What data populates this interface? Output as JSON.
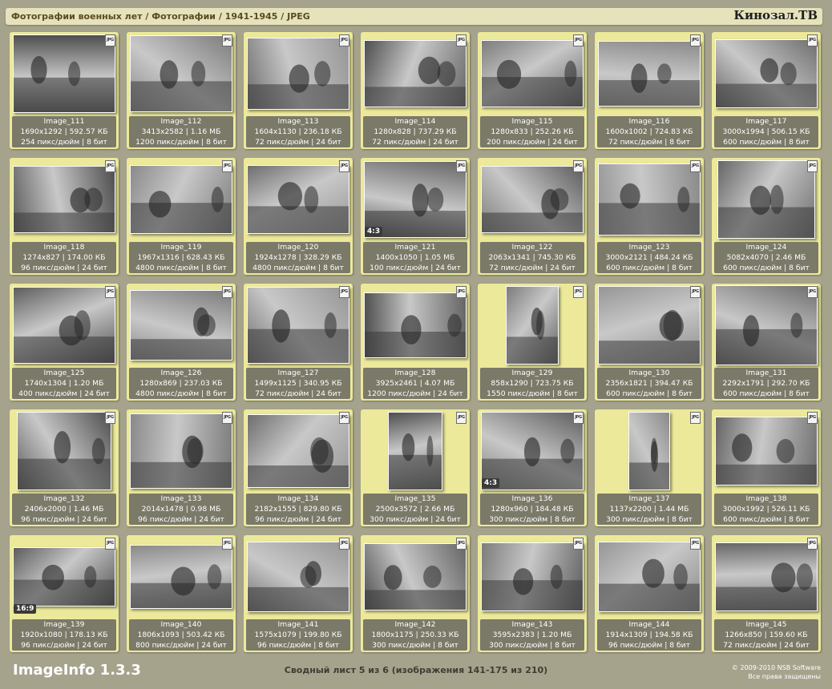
{
  "header": {
    "breadcrumb": "Фотографии военных лет / Фотографии / 1941-1945 / JPEG",
    "site": "Кинозал.ТВ"
  },
  "footer": {
    "app_name": "ImageInfo 1.3.3",
    "summary": "Сводный лист 5 из 6 (изображения 141-175 из 210)",
    "copyright": "© 2009-2010 NSB Software",
    "rights": "Все права защищены"
  },
  "file_type_icon": "jpg-file-icon",
  "images": [
    {
      "name": "Image_111",
      "dims": "1690x1292 | 592.57 КБ",
      "meta": "254 пикс/дюйм | 8 бит"
    },
    {
      "name": "Image_112",
      "dims": "3413x2582 | 1.16 МБ",
      "meta": "1200 пикс/дюйм | 8 бит"
    },
    {
      "name": "Image_113",
      "dims": "1604x1130 | 236.18 КБ",
      "meta": "72 пикс/дюйм | 24 бит"
    },
    {
      "name": "Image_114",
      "dims": "1280x828 | 737.29 КБ",
      "meta": "72 пикс/дюйм | 24 бит"
    },
    {
      "name": "Image_115",
      "dims": "1280x833 | 252.26 КБ",
      "meta": "200 пикс/дюйм | 24 бит"
    },
    {
      "name": "Image_116",
      "dims": "1600x1002 | 724.83 КБ",
      "meta": "72 пикс/дюйм | 8 бит"
    },
    {
      "name": "Image_117",
      "dims": "3000x1994 | 506.15 КБ",
      "meta": "600 пикс/дюйм | 8 бит"
    },
    {
      "name": "Image_118",
      "dims": "1274x827 | 174.00 КБ",
      "meta": "96 пикс/дюйм | 24 бит"
    },
    {
      "name": "Image_119",
      "dims": "1967x1316 | 628.43 КБ",
      "meta": "4800 пикс/дюйм | 8 бит"
    },
    {
      "name": "Image_120",
      "dims": "1924x1278 | 328.29 КБ",
      "meta": "4800 пикс/дюйм | 8 бит"
    },
    {
      "name": "Image_121",
      "dims": "1400x1050 | 1.05 МБ",
      "meta": "100 пикс/дюйм | 24 бит",
      "badge": "4:3"
    },
    {
      "name": "Image_122",
      "dims": "2063x1341 | 745.30 КБ",
      "meta": "72 пикс/дюйм | 24 бит"
    },
    {
      "name": "Image_123",
      "dims": "3000x2121 | 484.24 КБ",
      "meta": "600 пикс/дюйм | 8 бит"
    },
    {
      "name": "Image_124",
      "dims": "5082x4070 | 2.46 МБ",
      "meta": "600 пикс/дюйм | 8 бит"
    },
    {
      "name": "Image_125",
      "dims": "1740x1304 | 1.20 МБ",
      "meta": "400 пикс/дюйм | 24 бит"
    },
    {
      "name": "Image_126",
      "dims": "1280x869 | 237.03 КБ",
      "meta": "4800 пикс/дюйм | 8 бит"
    },
    {
      "name": "Image_127",
      "dims": "1499x1125 | 340.95 КБ",
      "meta": "72 пикс/дюйм | 24 бит"
    },
    {
      "name": "Image_128",
      "dims": "3925x2461 | 4.07 МБ",
      "meta": "1200 пикс/дюйм | 24 бит"
    },
    {
      "name": "Image_129",
      "dims": "858x1290 | 723.75 КБ",
      "meta": "1550 пикс/дюйм | 8 бит"
    },
    {
      "name": "Image_130",
      "dims": "2356x1821 | 394.47 КБ",
      "meta": "600 пикс/дюйм | 8 бит"
    },
    {
      "name": "Image_131",
      "dims": "2292x1791 | 292.70 КБ",
      "meta": "600 пикс/дюйм | 8 бит"
    },
    {
      "name": "Image_132",
      "dims": "2406x2000 | 1.46 МБ",
      "meta": "96 пикс/дюйм | 24 бит"
    },
    {
      "name": "Image_133",
      "dims": "2014x1478 | 0.98 МБ",
      "meta": "96 пикс/дюйм | 24 бит"
    },
    {
      "name": "Image_134",
      "dims": "2182x1555 | 829.80 КБ",
      "meta": "96 пикс/дюйм | 24 бит"
    },
    {
      "name": "Image_135",
      "dims": "2500x3572 | 2.66 МБ",
      "meta": "300 пикс/дюйм | 24 бит"
    },
    {
      "name": "Image_136",
      "dims": "1280x960 | 184.48 КБ",
      "meta": "300 пикс/дюйм | 8 бит",
      "badge": "4:3"
    },
    {
      "name": "Image_137",
      "dims": "1137x2200 | 1.44 МБ",
      "meta": "300 пикс/дюйм | 8 бит"
    },
    {
      "name": "Image_138",
      "dims": "3000x1992 | 526.11 КБ",
      "meta": "600 пикс/дюйм | 8 бит"
    },
    {
      "name": "Image_139",
      "dims": "1920x1080 | 178.13 КБ",
      "meta": "96 пикс/дюйм | 24 бит",
      "badge": "16:9"
    },
    {
      "name": "Image_140",
      "dims": "1806x1093 | 503.42 КБ",
      "meta": "800 пикс/дюйм | 24 бит"
    },
    {
      "name": "Image_141",
      "dims": "1575x1079 | 199.80 КБ",
      "meta": "96 пикс/дюйм | 8 бит"
    },
    {
      "name": "Image_142",
      "dims": "1800x1175 | 250.33 КБ",
      "meta": "300 пикс/дюйм | 8 бит"
    },
    {
      "name": "Image_143",
      "dims": "3595x2383 | 1.20 МБ",
      "meta": "300 пикс/дюйм | 8 бит"
    },
    {
      "name": "Image_144",
      "dims": "1914x1309 | 194.58 КБ",
      "meta": "96 пикс/дюйм | 8 бит"
    },
    {
      "name": "Image_145",
      "dims": "1266x850 | 159.60 КБ",
      "meta": "72 пикс/дюйм | 24 бит"
    }
  ]
}
